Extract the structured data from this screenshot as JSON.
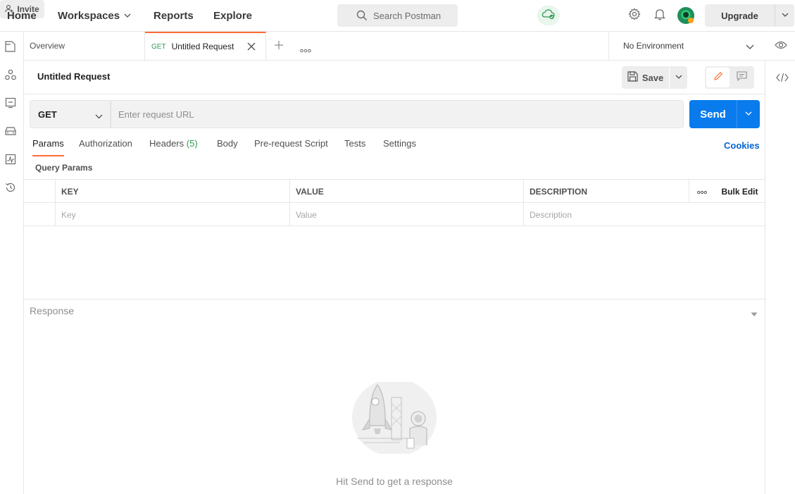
{
  "header": {
    "nav": {
      "home": "Home",
      "workspaces": "Workspaces",
      "reports": "Reports",
      "explore": "Explore"
    },
    "search_placeholder": "Search Postman",
    "invite_label": "Invite",
    "upgrade_label": "Upgrade"
  },
  "tabs": {
    "overview_label": "Overview",
    "active": {
      "method": "GET",
      "label": "Untitled Request"
    },
    "environment": "No Environment"
  },
  "request": {
    "title": "Untitled Request",
    "save_label": "Save",
    "method": "GET",
    "url_placeholder": "Enter request URL",
    "send_label": "Send",
    "tabs": {
      "params": "Params",
      "authorization": "Authorization",
      "headers": "Headers",
      "headers_count": "(5)",
      "body": "Body",
      "prerequest": "Pre-request Script",
      "tests": "Tests",
      "settings": "Settings"
    },
    "cookies_label": "Cookies",
    "query_params_label": "Query Params",
    "table": {
      "columns": {
        "key": "KEY",
        "value": "VALUE",
        "description": "DESCRIPTION"
      },
      "bulk_edit": "Bulk Edit",
      "placeholders": {
        "key": "Key",
        "value": "Value",
        "description": "Description"
      }
    }
  },
  "response": {
    "label": "Response",
    "hint": "Hit Send to get a response"
  },
  "colors": {
    "accent": "#ff6c37",
    "send_blue": "#097bed",
    "method_green": "#2f9a56",
    "link_blue": "#0265d2"
  }
}
